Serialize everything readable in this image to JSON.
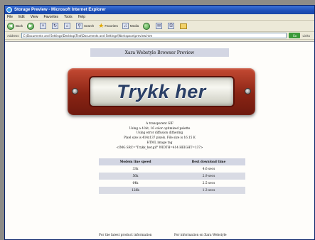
{
  "window": {
    "title": "Storage Preview - Microsoft Internet Explorer"
  },
  "menu": [
    "File",
    "Edit",
    "View",
    "Favorites",
    "Tools",
    "Help"
  ],
  "toolbar": {
    "back": "Back",
    "search": "Search",
    "favorites": "Favorites",
    "media": "Media"
  },
  "address": {
    "label": "Address",
    "value": "C:\\Documents and Settings\\Desktop\\Test\\Documents and Settings\\Workspace\\preview.htm",
    "go": "Go",
    "links": "Links"
  },
  "page": {
    "title": "Xara Webstyle Browser Preview",
    "button_text": "Trykk her",
    "info": [
      "A transparent GIF",
      "Using a 4 bit, 16 color optimized palette",
      "Using error diffusion dithering",
      "Pixel size is 414x137 pixels. File size is 16.15 K",
      "HTML image tag",
      "<IMG SRC=\"Trykk_her.gif\" WIDTH=414 HEIGHT=137>"
    ],
    "table": {
      "headers": [
        "Modem line speed",
        "Best download time"
      ],
      "rows": [
        [
          "33k",
          "4.6 secs"
        ],
        [
          "56k",
          "2.9 secs"
        ],
        [
          "64k",
          "2.5 secs"
        ],
        [
          "128k",
          "1.3 secs"
        ]
      ]
    },
    "footer": {
      "left": "For the latest product information",
      "right": "For information on Xara Webstyle"
    }
  }
}
